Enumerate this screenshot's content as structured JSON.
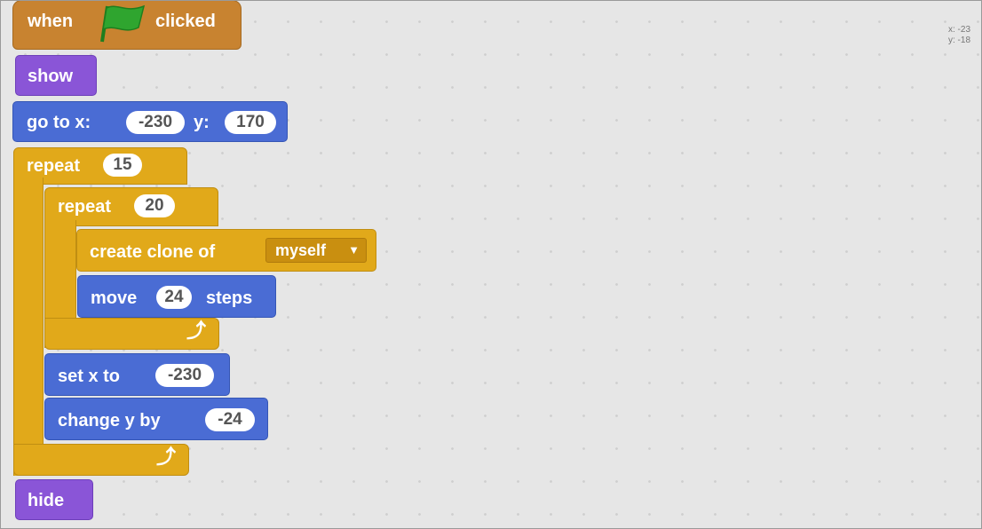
{
  "blocks": {
    "when_flag": {
      "when": "when",
      "clicked": "clicked"
    },
    "show": "show",
    "goto": {
      "label": "go to x:",
      "x": "-230",
      "ylabel": "y:",
      "y": "170"
    },
    "repeat_outer": {
      "label": "repeat",
      "count": "15"
    },
    "repeat_inner": {
      "label": "repeat",
      "count": "20"
    },
    "create_clone": {
      "label": "create clone of",
      "target": "myself"
    },
    "move": {
      "label": "move",
      "steps": "24",
      "unit": "steps"
    },
    "set_x": {
      "label": "set x to",
      "value": "-230"
    },
    "change_y": {
      "label": "change y by",
      "value": "-24"
    },
    "hide": "hide"
  },
  "stage_coords": {
    "x": "x: -23",
    "y": "y: -18"
  },
  "colors": {
    "events": "#c88330",
    "looks": "#8a55d7",
    "motion": "#4a6cd4",
    "control": "#e1a91a",
    "flag": "#2fa52f"
  }
}
